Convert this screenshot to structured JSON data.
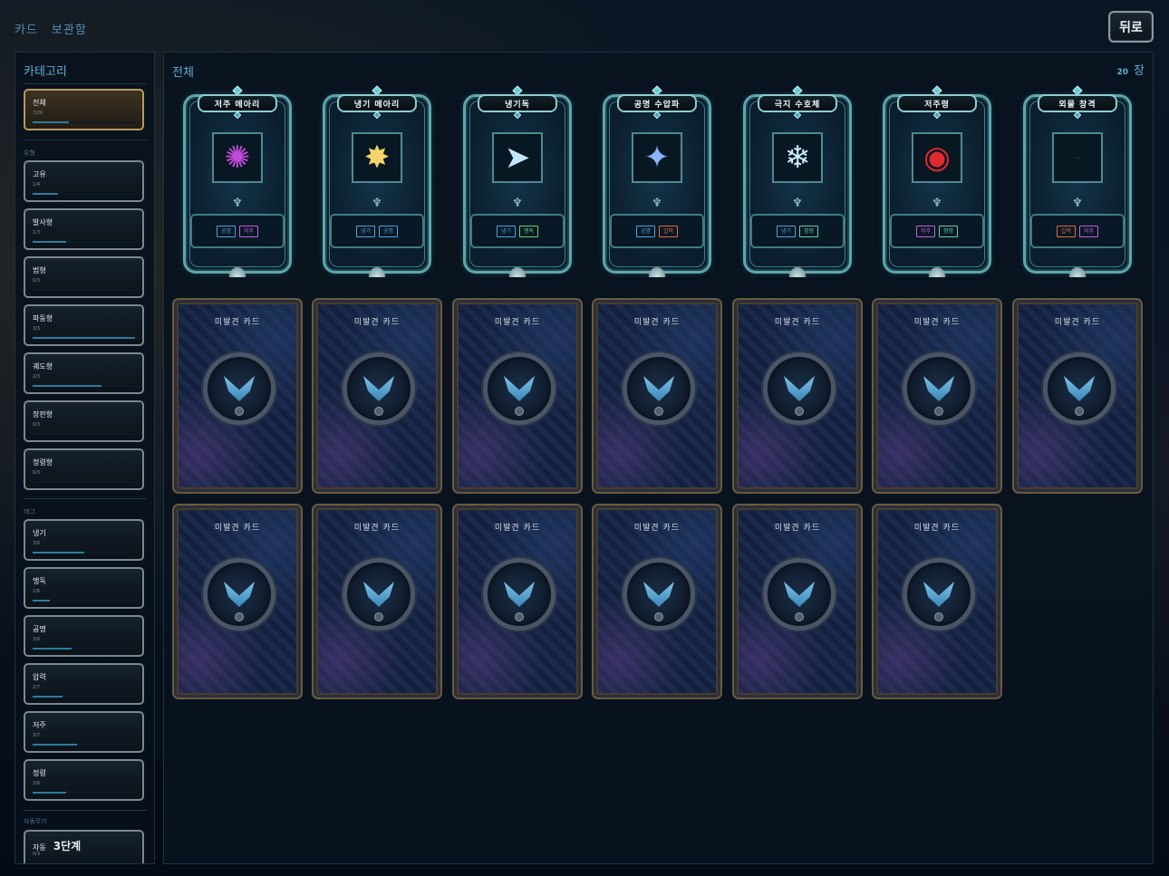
{
  "header": {
    "crumbs": [
      "카드",
      "보관함"
    ],
    "back_label": "뒤로"
  },
  "sidebar": {
    "title": "카테고리",
    "all": {
      "label": "전체",
      "count": "7/20",
      "progress": 0.35
    },
    "type_section": "유형",
    "types": [
      {
        "label": "고유",
        "count": "1/4",
        "progress": 0.25
      },
      {
        "label": "발사형",
        "count": "1/3",
        "progress": 0.33
      },
      {
        "label": "범형",
        "count": "0/3",
        "progress": 0.0
      },
      {
        "label": "파동형",
        "count": "3/3",
        "progress": 1.0
      },
      {
        "label": "궤도형",
        "count": "2/3",
        "progress": 0.67
      },
      {
        "label": "장판형",
        "count": "0/3",
        "progress": 0.0
      },
      {
        "label": "정령형",
        "count": "0/3",
        "progress": 0.0
      }
    ],
    "tag_section": "태그",
    "tags": [
      {
        "label": "냉기",
        "count": "3/6",
        "progress": 0.5
      },
      {
        "label": "맹독",
        "count": "1/6",
        "progress": 0.17
      },
      {
        "label": "공명",
        "count": "3/8",
        "progress": 0.38
      },
      {
        "label": "압력",
        "count": "2/7",
        "progress": 0.29
      },
      {
        "label": "저주",
        "count": "3/7",
        "progress": 0.43
      },
      {
        "label": "정령",
        "count": "2/6",
        "progress": 0.33
      }
    ],
    "auto_section": "자동무기",
    "auto": {
      "label": "자동",
      "level": "3단계",
      "count": "0/3"
    }
  },
  "main": {
    "title": "전체",
    "count_num": "20",
    "count_unit": "장",
    "revealed_cards": [
      {
        "name": "저주 메아리",
        "art": "✺",
        "art_color": "#c04ad8",
        "tags": [
          {
            "text": "공명",
            "color": "#4aa3e0"
          },
          {
            "text": "저주",
            "color": "#c35ce0"
          }
        ]
      },
      {
        "name": "냉기 메아리",
        "art": "✸",
        "art_color": "#f3d46a",
        "tags": [
          {
            "text": "냉기",
            "color": "#4aa3e0"
          },
          {
            "text": "공명",
            "color": "#4aa3e0"
          }
        ]
      },
      {
        "name": "냉기독",
        "art": "➤",
        "art_color": "#bfe8ff",
        "tags": [
          {
            "text": "냉기",
            "color": "#4aa3e0"
          },
          {
            "text": "맹독",
            "color": "#5ed07a"
          }
        ]
      },
      {
        "name": "공명 수압파",
        "art": "✦",
        "art_color": "#8ab4ff",
        "tags": [
          {
            "text": "공명",
            "color": "#4aa3e0"
          },
          {
            "text": "압력",
            "color": "#e0674a"
          }
        ]
      },
      {
        "name": "극지 수호체",
        "art": "❄",
        "art_color": "#cdeeff",
        "tags": [
          {
            "text": "냉기",
            "color": "#4aa3e0"
          },
          {
            "text": "정령",
            "color": "#5ed0b0"
          }
        ]
      },
      {
        "name": "저주령",
        "art": "◉",
        "art_color": "#e0282e",
        "tags": [
          {
            "text": "저주",
            "color": "#c35ce0"
          },
          {
            "text": "정령",
            "color": "#5ed0b0"
          }
        ]
      },
      {
        "name": "외물 창격",
        "art": "---",
        "art_color": "#3c5e70",
        "tags": [
          {
            "text": "압력",
            "color": "#e0674a"
          },
          {
            "text": "저주",
            "color": "#c35ce0"
          }
        ]
      }
    ],
    "unrevealed_label": "미발견 카드",
    "unrevealed_count": 13
  },
  "colors": {
    "accent": "#5fb0d8",
    "frame": "#5fa5ad",
    "active_border": "#b89a63"
  }
}
